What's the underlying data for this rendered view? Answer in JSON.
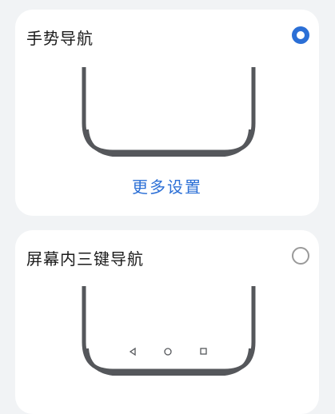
{
  "gesture_nav": {
    "title": "手势导航",
    "selected": true,
    "more_settings_label": "更多设置"
  },
  "three_key_nav": {
    "title": "屏幕内三键导航",
    "selected": false,
    "nav_icons": [
      "back-triangle-icon",
      "home-circle-icon",
      "recents-square-icon"
    ]
  },
  "colors": {
    "accent": "#2b6fd6",
    "phone_outline": "#55575b",
    "card_bg": "#ffffff",
    "page_bg": "#f1f3f5"
  }
}
